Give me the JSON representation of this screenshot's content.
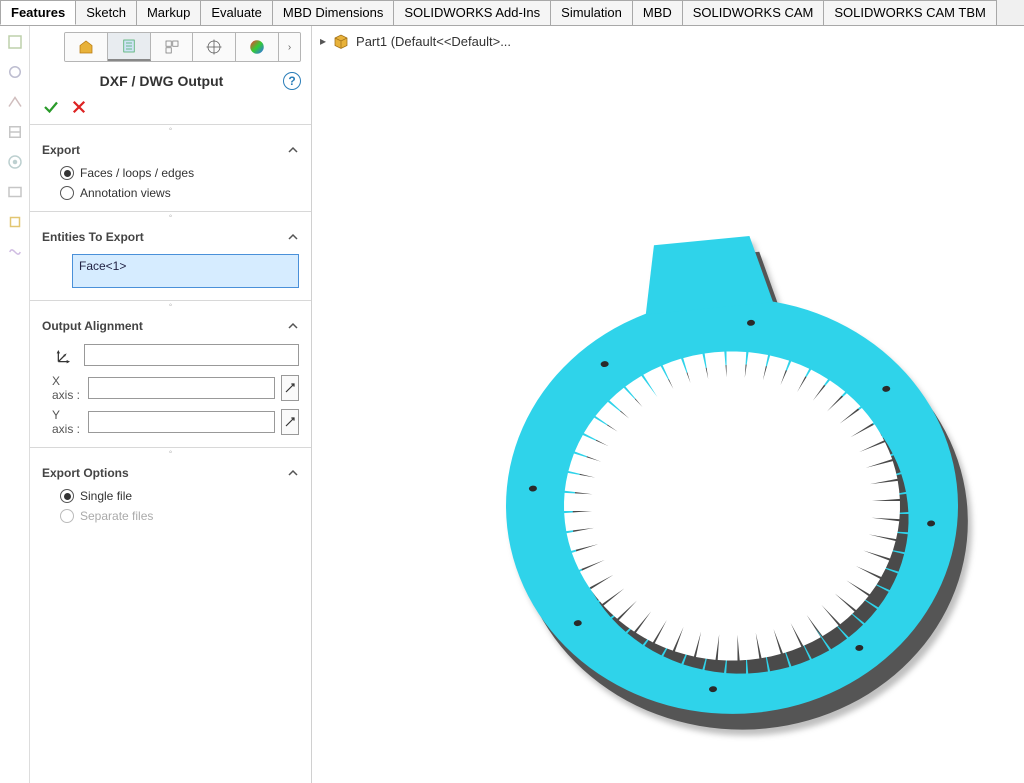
{
  "ribbon": {
    "tabs": [
      "Features",
      "Sketch",
      "Markup",
      "Evaluate",
      "MBD Dimensions",
      "SOLIDWORKS Add-Ins",
      "Simulation",
      "MBD",
      "SOLIDWORKS CAM",
      "SOLIDWORKS CAM TBM"
    ],
    "active": 0
  },
  "panel": {
    "title": "DXF / DWG Output",
    "sections": {
      "export": {
        "head": "Export",
        "opt1": "Faces / loops / edges",
        "opt2": "Annotation views",
        "selected": 0
      },
      "entities": {
        "head": "Entities To Export",
        "items": [
          "Face<1>"
        ]
      },
      "alignment": {
        "head": "Output Alignment",
        "xaxis_label": "X axis :",
        "yaxis_label": "Y axis :",
        "primary_value": "",
        "xaxis_value": "",
        "yaxis_value": ""
      },
      "options": {
        "head": "Export Options",
        "opt1": "Single file",
        "opt2": "Separate files",
        "selected": 0
      }
    }
  },
  "viewport": {
    "breadcrumb": "Part1  (Default<<Default>..."
  },
  "colors": {
    "face": "#2fd3ea",
    "thick": "#6b6b6b"
  }
}
